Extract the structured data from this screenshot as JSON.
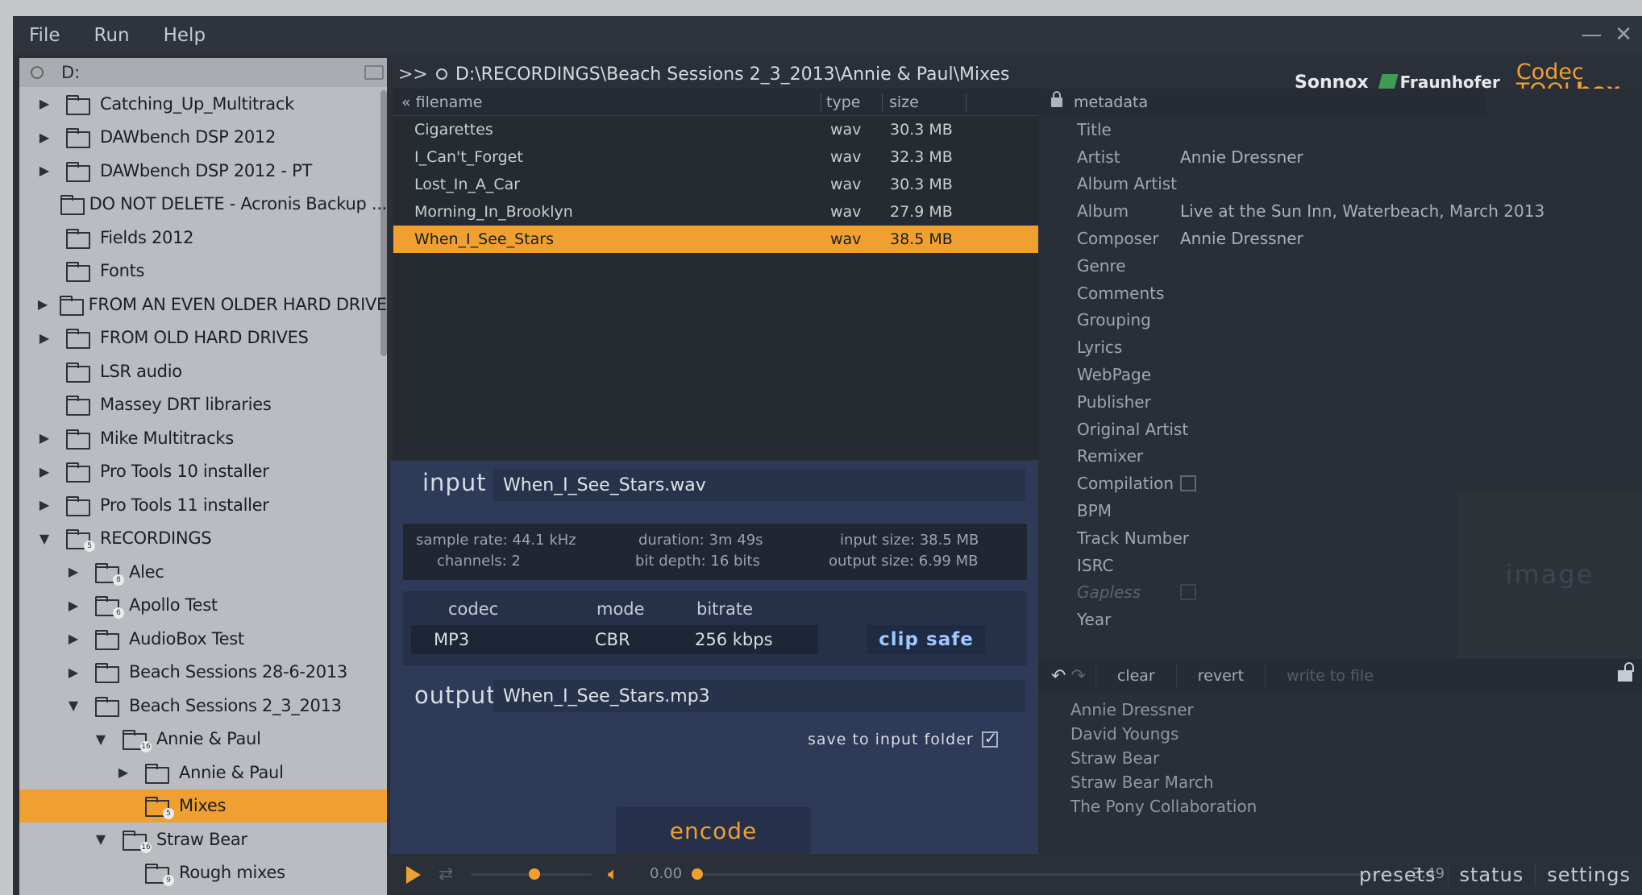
{
  "menu": [
    "File",
    "Run",
    "Help"
  ],
  "window_controls": {
    "minimize": "—",
    "close": "✕"
  },
  "tree": {
    "drive": "D:",
    "items": [
      {
        "label": "Catching_Up_Multitrack",
        "indent": 0,
        "arrow": "▶",
        "count": ""
      },
      {
        "label": "DAWbench DSP 2012",
        "indent": 0,
        "arrow": "▶",
        "count": ""
      },
      {
        "label": "DAWbench DSP 2012 - PT",
        "indent": 0,
        "arrow": "▶",
        "count": ""
      },
      {
        "label": "DO NOT DELETE - Acronis Backup ...",
        "indent": 0,
        "arrow": "",
        "count": ""
      },
      {
        "label": "Fields 2012",
        "indent": 0,
        "arrow": "",
        "count": ""
      },
      {
        "label": "Fonts",
        "indent": 0,
        "arrow": "",
        "count": ""
      },
      {
        "label": "FROM AN EVEN OLDER HARD DRIVE",
        "indent": 0,
        "arrow": "▶",
        "count": ""
      },
      {
        "label": "FROM OLD HARD DRIVES",
        "indent": 0,
        "arrow": "▶",
        "count": ""
      },
      {
        "label": "LSR audio",
        "indent": 0,
        "arrow": "",
        "count": ""
      },
      {
        "label": "Massey DRT libraries",
        "indent": 0,
        "arrow": "",
        "count": ""
      },
      {
        "label": "Mike Multitracks",
        "indent": 0,
        "arrow": "▶",
        "count": ""
      },
      {
        "label": "Pro Tools 10 installer",
        "indent": 0,
        "arrow": "▶",
        "count": ""
      },
      {
        "label": "Pro Tools 11 installer",
        "indent": 0,
        "arrow": "▶",
        "count": ""
      },
      {
        "label": "RECORDINGS",
        "indent": 0,
        "arrow": "▼",
        "count": "5"
      },
      {
        "label": "Alec",
        "indent": 1,
        "arrow": "▶",
        "count": "8"
      },
      {
        "label": "Apollo Test",
        "indent": 1,
        "arrow": "▶",
        "count": "6"
      },
      {
        "label": "AudioBox Test",
        "indent": 1,
        "arrow": "▶",
        "count": ""
      },
      {
        "label": "Beach Sessions 28-6-2013",
        "indent": 1,
        "arrow": "▶",
        "count": ""
      },
      {
        "label": "Beach Sessions 2_3_2013",
        "indent": 1,
        "arrow": "▼",
        "count": ""
      },
      {
        "label": "Annie & Paul",
        "indent": 2,
        "arrow": "▼",
        "count": "16"
      },
      {
        "label": "Annie & Paul",
        "indent": 3,
        "arrow": "▶",
        "count": ""
      },
      {
        "label": "Mixes",
        "indent": 3,
        "arrow": "",
        "count": "5",
        "selected": true
      },
      {
        "label": "Straw Bear",
        "indent": 2,
        "arrow": "▼",
        "count": "16"
      },
      {
        "label": "Rough mixes",
        "indent": 3,
        "arrow": "",
        "count": "9"
      }
    ]
  },
  "path": {
    "prefix": ">>",
    "value": "D:\\RECORDINGS\\Beach Sessions 2_3_2013\\Annie & Paul\\Mixes"
  },
  "logos": {
    "sonnox": "Sonnox",
    "fraunhofer": "Fraunhofer",
    "codec_line1": "Codec",
    "codec_line2_a": "TOOL",
    "codec_line2_b": "box"
  },
  "filelist": {
    "headers": {
      "name": "filename",
      "type": "type",
      "size": "size"
    },
    "rows": [
      {
        "name": "Cigarettes",
        "type": "wav",
        "size": "30.3 MB"
      },
      {
        "name": "I_Can't_Forget",
        "type": "wav",
        "size": "32.3 MB"
      },
      {
        "name": "Lost_In_A_Car",
        "type": "wav",
        "size": "30.3 MB"
      },
      {
        "name": "Morning_In_Brooklyn",
        "type": "wav",
        "size": "27.9 MB"
      },
      {
        "name": "When_I_See_Stars",
        "type": "wav",
        "size": "38.5 MB",
        "selected": true
      }
    ]
  },
  "input": {
    "label": "input",
    "file": "When_I_See_Stars.wav",
    "sample_rate": "sample rate: 44.1 kHz",
    "channels": "channels: 2",
    "duration": "duration: 3m 49s",
    "bit_depth": "bit depth: 16 bits",
    "input_size": "input size: 38.5 MB",
    "output_size": "output size: 6.99 MB"
  },
  "codec": {
    "codec_head": "codec",
    "mode_head": "mode",
    "bitrate_head": "bitrate",
    "codec": "MP3",
    "mode": "CBR",
    "bitrate": "256 kbps",
    "clip_safe": "clip safe"
  },
  "output": {
    "label": "output",
    "file": "When_I_See_Stars.mp3",
    "save_label": "save to input folder",
    "save_checked": true
  },
  "encode_label": "encode",
  "transport": {
    "time_start": "0.00",
    "time_end": "3.49"
  },
  "bottom_tabs": [
    "presets",
    "status",
    "settings"
  ],
  "metadata": {
    "header": "metadata",
    "fields": [
      {
        "key": "Title",
        "value": ""
      },
      {
        "key": "Artist",
        "value": "Annie Dressner"
      },
      {
        "key": "Album Artist",
        "value": ""
      },
      {
        "key": "Album",
        "value": "Live at the Sun Inn, Waterbeach, March 2013"
      },
      {
        "key": "Composer",
        "value": "Annie Dressner"
      },
      {
        "key": "Genre",
        "value": ""
      },
      {
        "key": "Comments",
        "value": ""
      },
      {
        "key": "Grouping",
        "value": ""
      },
      {
        "key": "Lyrics",
        "value": ""
      },
      {
        "key": "WebPage",
        "value": ""
      },
      {
        "key": "Publisher",
        "value": ""
      },
      {
        "key": "Original Artist",
        "value": ""
      },
      {
        "key": "Remixer",
        "value": ""
      },
      {
        "key": "Compilation",
        "value": "",
        "checkbox": true
      },
      {
        "key": "BPM",
        "value": ""
      },
      {
        "key": "Track Number",
        "value": ""
      },
      {
        "key": "ISRC",
        "value": ""
      },
      {
        "key": "Gapless",
        "value": "",
        "checkbox": true,
        "dim": true
      },
      {
        "key": "Year",
        "value": ""
      }
    ],
    "image_placeholder": "image",
    "actions": {
      "clear": "clear",
      "revert": "revert",
      "write": "write to file"
    },
    "suggestions": [
      "Annie Dressner",
      "David Youngs",
      "Straw Bear",
      "Straw Bear March",
      "The Pony Collaboration"
    ]
  },
  "colors": {
    "accent": "#f0a030",
    "panel": "#2d3a58",
    "tree_bg": "#b9bcc0"
  }
}
